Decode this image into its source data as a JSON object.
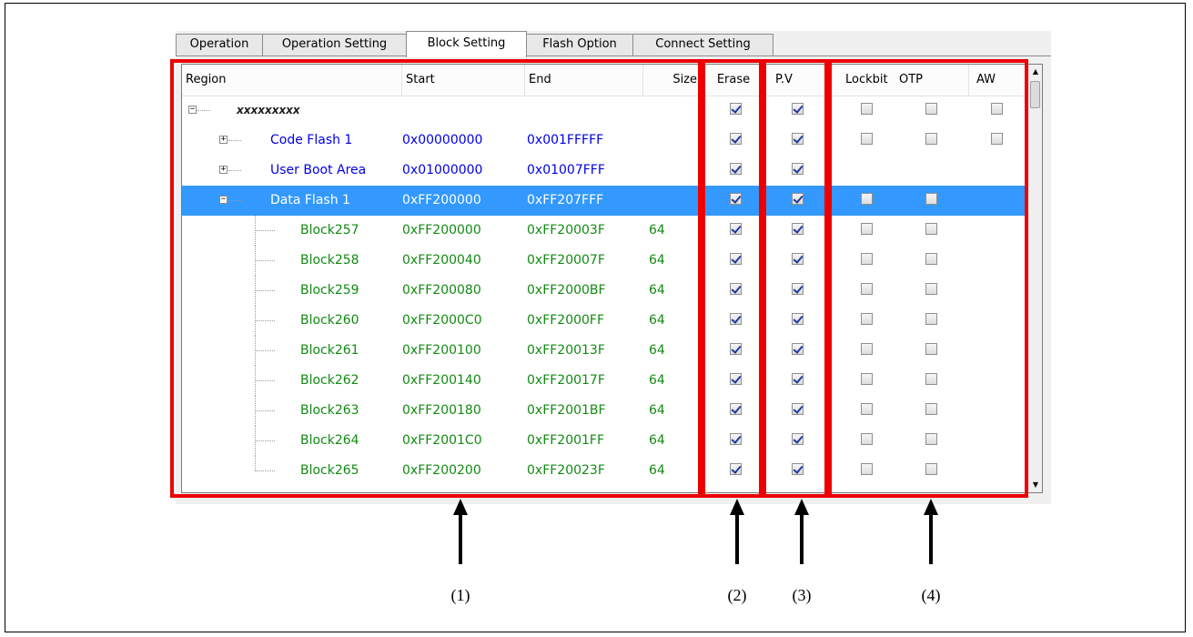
{
  "tabs": [
    {
      "label": "Operation",
      "active": false
    },
    {
      "label": "Operation Setting",
      "active": false
    },
    {
      "label": "Block Setting",
      "active": true
    },
    {
      "label": "Flash Option",
      "active": false
    },
    {
      "label": "Connect Setting",
      "active": false
    }
  ],
  "columns": {
    "region": "Region",
    "start": "Start",
    "end": "End",
    "size": "Size",
    "erase": "Erase",
    "pv": "P.V",
    "lockbit": "Lockbit",
    "otp": "OTP",
    "aw": "AW"
  },
  "rows": [
    {
      "region": "xxxxxxxxx",
      "start": "",
      "end": "",
      "size": "",
      "level": 0,
      "expander": "minus",
      "color": "dark",
      "selected": false,
      "erase": true,
      "pv": true,
      "lockbit": false,
      "otp": false,
      "aw": false
    },
    {
      "region": "Code Flash 1",
      "start": "0x00000000",
      "end": "0x001FFFFF",
      "size": "",
      "level": 1,
      "expander": "plus",
      "color": "blue",
      "selected": false,
      "erase": true,
      "pv": true,
      "lockbit": false,
      "otp": false,
      "aw": false
    },
    {
      "region": "User Boot Area",
      "start": "0x01000000",
      "end": "0x01007FFF",
      "size": "",
      "level": 1,
      "expander": "plus",
      "color": "blue",
      "selected": false,
      "erase": true,
      "pv": true,
      "lockbit": null,
      "otp": null,
      "aw": null
    },
    {
      "region": "Data Flash 1",
      "start": "0xFF200000",
      "end": "0xFF207FFF",
      "size": "",
      "level": 1,
      "expander": "minus",
      "color": "white",
      "selected": true,
      "erase": true,
      "pv": true,
      "lockbit": false,
      "otp": false,
      "aw": null
    },
    {
      "region": "Block257",
      "start": "0xFF200000",
      "end": "0xFF20003F",
      "size": "64",
      "level": 2,
      "expander": "",
      "color": "green",
      "selected": false,
      "erase": true,
      "pv": true,
      "lockbit": false,
      "otp": false,
      "aw": null
    },
    {
      "region": "Block258",
      "start": "0xFF200040",
      "end": "0xFF20007F",
      "size": "64",
      "level": 2,
      "expander": "",
      "color": "green",
      "selected": false,
      "erase": true,
      "pv": true,
      "lockbit": false,
      "otp": false,
      "aw": null
    },
    {
      "region": "Block259",
      "start": "0xFF200080",
      "end": "0xFF2000BF",
      "size": "64",
      "level": 2,
      "expander": "",
      "color": "green",
      "selected": false,
      "erase": true,
      "pv": true,
      "lockbit": false,
      "otp": false,
      "aw": null
    },
    {
      "region": "Block260",
      "start": "0xFF2000C0",
      "end": "0xFF2000FF",
      "size": "64",
      "level": 2,
      "expander": "",
      "color": "green",
      "selected": false,
      "erase": true,
      "pv": true,
      "lockbit": false,
      "otp": false,
      "aw": null
    },
    {
      "region": "Block261",
      "start": "0xFF200100",
      "end": "0xFF20013F",
      "size": "64",
      "level": 2,
      "expander": "",
      "color": "green",
      "selected": false,
      "erase": true,
      "pv": true,
      "lockbit": false,
      "otp": false,
      "aw": null
    },
    {
      "region": "Block262",
      "start": "0xFF200140",
      "end": "0xFF20017F",
      "size": "64",
      "level": 2,
      "expander": "",
      "color": "green",
      "selected": false,
      "erase": true,
      "pv": true,
      "lockbit": false,
      "otp": false,
      "aw": null
    },
    {
      "region": "Block263",
      "start": "0xFF200180",
      "end": "0xFF2001BF",
      "size": "64",
      "level": 2,
      "expander": "",
      "color": "green",
      "selected": false,
      "erase": true,
      "pv": true,
      "lockbit": false,
      "otp": false,
      "aw": null
    },
    {
      "region": "Block264",
      "start": "0xFF2001C0",
      "end": "0xFF2001FF",
      "size": "64",
      "level": 2,
      "expander": "",
      "color": "green",
      "selected": false,
      "erase": true,
      "pv": true,
      "lockbit": false,
      "otp": false,
      "aw": null
    },
    {
      "region": "Block265",
      "start": "0xFF200200",
      "end": "0xFF20023F",
      "size": "64",
      "level": 2,
      "expander": "",
      "color": "green",
      "selected": false,
      "erase": true,
      "pv": true,
      "lockbit": false,
      "otp": false,
      "aw": null
    }
  ],
  "callouts": [
    "(1)",
    "(2)",
    "(3)",
    "(4)"
  ],
  "colors": {
    "blue_text": "#0000e6",
    "green_text": "#138a13",
    "selection": "#3399ff",
    "highlight_box": "#ee0000"
  },
  "icons": {
    "expand": "plus-box-icon",
    "collapse": "minus-box-icon",
    "scroll_up": "triangle-up-icon",
    "scroll_down": "triangle-down-icon"
  }
}
